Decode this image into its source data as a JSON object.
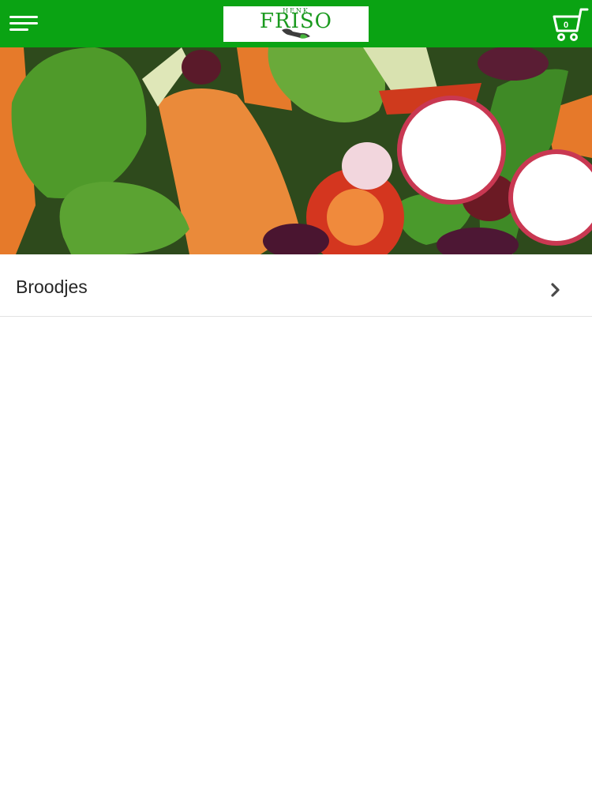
{
  "header": {
    "menu_icon": "hamburger-menu-icon",
    "logo": {
      "subtitle": "HENK",
      "name": "FRISO"
    },
    "cart": {
      "icon": "shopping-cart-icon",
      "count": "0"
    }
  },
  "hero": {
    "image": "salad-banner"
  },
  "categories": [
    {
      "label": "Broodjes",
      "icon": "chevron-right-icon"
    }
  ],
  "colors": {
    "brand_green": "#0aa313"
  }
}
